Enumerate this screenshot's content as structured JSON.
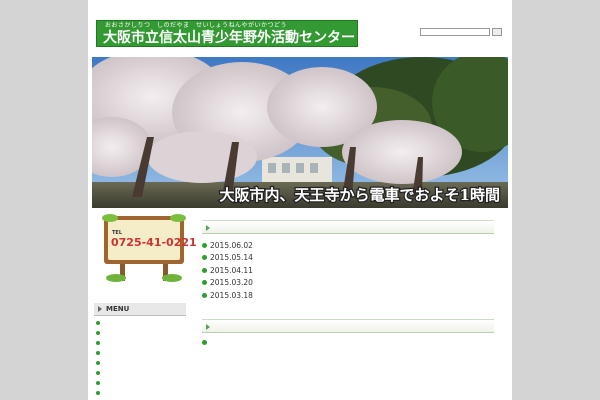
{
  "header": {
    "tagline": "",
    "logo_ruby": "おおさかしりつ　しのだやま　せいしょうねんやがいかつどう",
    "logo_title": "大阪市立信太山青少年野外活動センター",
    "sitemap_link": "",
    "search_label": "",
    "search_placeholder": "",
    "search_button": ""
  },
  "hero": {
    "caption": "大阪市内、天王寺から電車でおよそ1時間"
  },
  "sidebar": {
    "contact_board": {
      "heading": "",
      "tel_label": "TEL",
      "phone": "0725-41-0221",
      "hours": ""
    },
    "menu_header": "MENU",
    "menu_items": [
      {
        "label": ""
      },
      {
        "label": ""
      },
      {
        "label": ""
      },
      {
        "label": ""
      },
      {
        "label": ""
      },
      {
        "label": ""
      },
      {
        "label": ""
      },
      {
        "label": ""
      }
    ]
  },
  "news": {
    "header": "",
    "items": [
      {
        "date": "2015.06.02",
        "title": ""
      },
      {
        "date": "2015.05.14",
        "title": ""
      },
      {
        "date": "2015.04.11",
        "title": ""
      },
      {
        "date": "2015.03.20",
        "title": ""
      },
      {
        "date": "2015.03.18",
        "title": ""
      }
    ]
  },
  "events": {
    "header": "",
    "link": "",
    "lines": [
      "",
      ""
    ],
    "schedule": [
      "",
      "",
      ""
    ]
  },
  "colors": {
    "brand_green": "#339933",
    "link_green": "#2a6e2a",
    "bullet_green": "#2e9e2e"
  }
}
